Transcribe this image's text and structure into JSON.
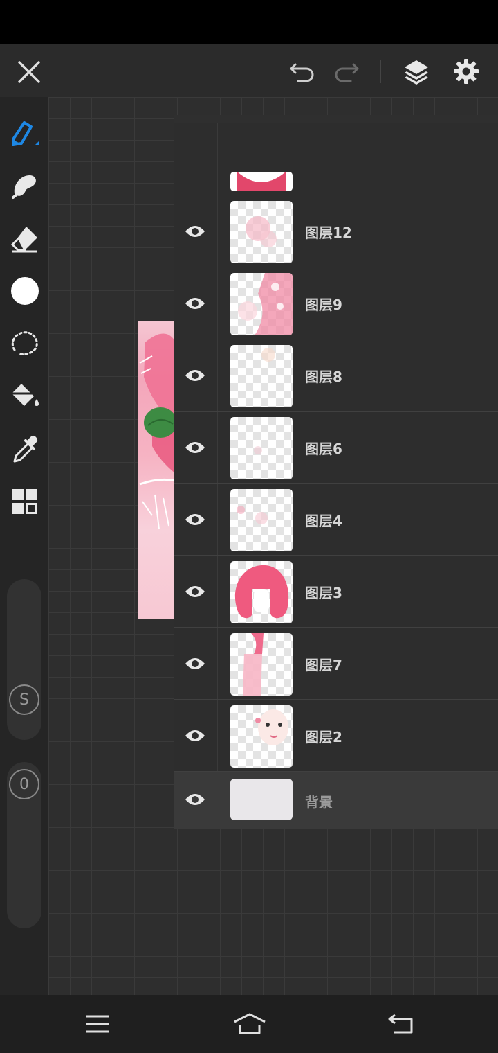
{
  "top_bar": {
    "close_icon": "close-icon",
    "undo_icon": "undo-icon",
    "redo_icon": "redo-icon",
    "layers_icon": "layers-icon",
    "settings_icon": "gear-icon"
  },
  "left_toolbar": {
    "tools": [
      "brush-icon",
      "smudge-icon",
      "eraser-icon",
      "color-icon",
      "lasso-icon",
      "fill-icon",
      "eyedropper-icon",
      "grid-icon"
    ],
    "brush_color": "#1e88e5",
    "size_label": "S",
    "opacity_label": "0"
  },
  "layer_panel": {
    "toolbar": [
      "add-icon",
      "folder-icon",
      "lock-icon",
      "merge-down-icon",
      "transparency-icon",
      "target-icon"
    ],
    "layers": [
      {
        "name": "图层12"
      },
      {
        "name": "图层9"
      },
      {
        "name": "图层8"
      },
      {
        "name": "图层6"
      },
      {
        "name": "图层4"
      },
      {
        "name": "图层3"
      },
      {
        "name": "图层7"
      },
      {
        "name": "图层2"
      }
    ],
    "background_layer": {
      "name": "背景"
    }
  },
  "nav_bar": {
    "items": [
      "menu-icon",
      "home-icon",
      "back-icon"
    ]
  }
}
